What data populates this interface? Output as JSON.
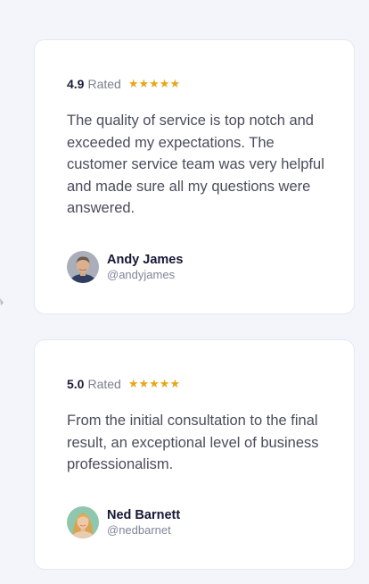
{
  "testimonials": [
    {
      "score": "4.9",
      "rated_label": "Rated",
      "stars": "★★★★★",
      "quote": "The quality of service is top notch and exceeded my expectations. The customer service team was very helpful and made sure all my questions were answered.",
      "name": "Andy James",
      "handle": "@andyjames",
      "avatar_icon": "user-avatar-male"
    },
    {
      "score": "5.0",
      "rated_label": "Rated",
      "stars": "★★★★★",
      "quote": "From the initial consultation to the final result, an exceptional level of business professionalism.",
      "name": "Ned Barnett",
      "handle": "@nedbarnet",
      "avatar_icon": "user-avatar-female"
    }
  ],
  "colors": {
    "page_background": "#f3f5fa",
    "card_background": "#ffffff",
    "star": "#e5a81b",
    "heading": "#1b1c3a",
    "body_text": "#4a4d5c",
    "muted": "#7a7f8f"
  }
}
